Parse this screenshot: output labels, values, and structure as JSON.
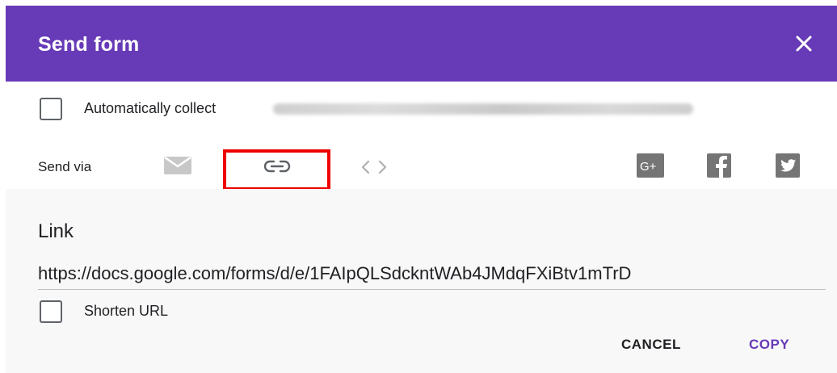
{
  "dialog": {
    "title": "Send form",
    "colors": {
      "header": "#673ab7",
      "accent": "#673ab7",
      "highlight": "#ee0000"
    }
  },
  "collect": {
    "label": "Automatically collect",
    "checked": false
  },
  "send_via": {
    "label": "Send via",
    "options": [
      "email-icon",
      "link-icon",
      "embed-icon"
    ],
    "selected": "link-icon",
    "social": [
      "google-plus-icon",
      "facebook-icon",
      "twitter-icon"
    ]
  },
  "link": {
    "heading": "Link",
    "url": "https://docs.google.com/forms/d/e/1FAIpQLSdckntWAb4JMdqFXiBtv1mTrD",
    "shorten_label": "Shorten URL",
    "shorten_checked": false
  },
  "actions": {
    "cancel_label": "CANCEL",
    "copy_label": "COPY"
  }
}
